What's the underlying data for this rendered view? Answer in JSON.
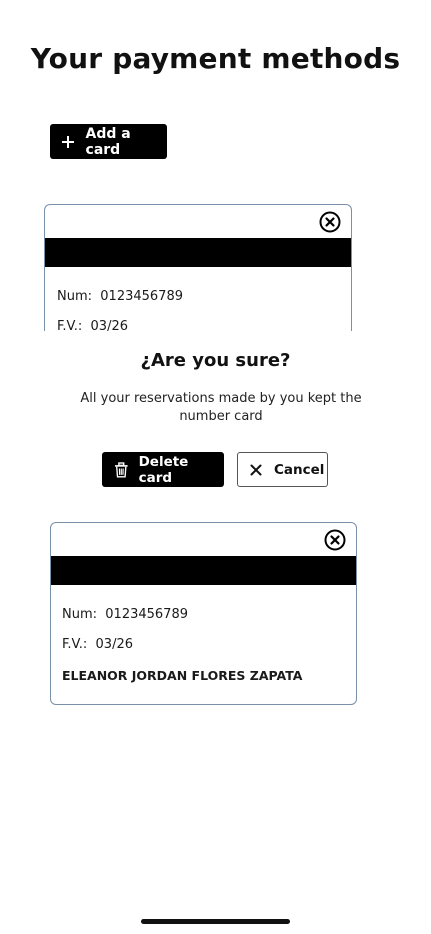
{
  "page": {
    "title": "Your payment methods"
  },
  "actions": {
    "add_card_label": "Add a card"
  },
  "cards": [
    {
      "number_label": "Num:",
      "number_value": "0123456789",
      "expiry_label": "F.V.:",
      "expiry_value": "03/26"
    },
    {
      "number_label": "Num:",
      "number_value": "0123456789",
      "expiry_label": "F.V.:",
      "expiry_value": "03/26",
      "holder_name": "ELEANOR JORDAN FLORES ZAPATA"
    }
  ],
  "confirm_dialog": {
    "title": "¿Are you sure?",
    "message": "All your reservations made by you kept the number card",
    "delete_label": "Delete card",
    "cancel_label": "Cancel"
  },
  "icons": {
    "add": "plus-icon",
    "remove_card": "close-circle-icon",
    "delete": "trash-icon",
    "cancel": "close-icon"
  },
  "colors": {
    "primary": "#000000",
    "card_border": "#7a8fa8",
    "background": "#ffffff"
  }
}
